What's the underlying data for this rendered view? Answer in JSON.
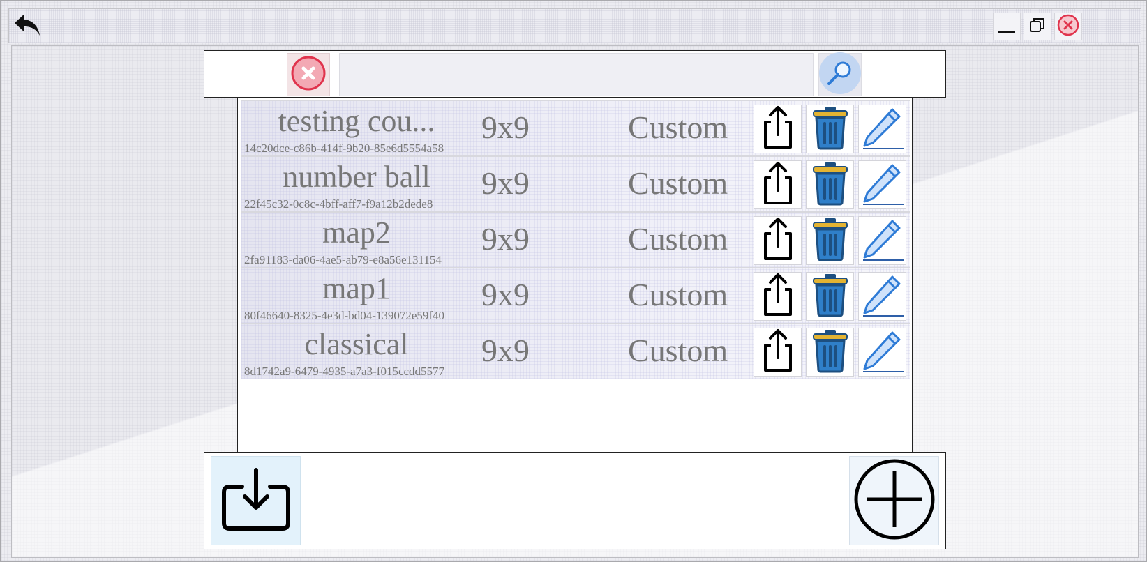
{
  "titlebar": {
    "icons": [
      "back-arrow-icon",
      "minimize-icon",
      "restore-icon",
      "close-icon"
    ]
  },
  "search": {
    "value": "",
    "placeholder": "",
    "icons": [
      "clear-icon",
      "search-magnifier-icon"
    ]
  },
  "maps": [
    {
      "name": "testing cou...",
      "id": "14c20dce-c86b-414f-9b20-85e6d5554a58",
      "size": "9x9",
      "type": "Custom"
    },
    {
      "name": "number ball",
      "id": "22f45c32-0c8c-4bff-aff7-f9a12b2dede8",
      "size": "9x9",
      "type": "Custom"
    },
    {
      "name": "map2",
      "id": "2fa91183-da06-4ae5-ab79-e8a56e131154",
      "size": "9x9",
      "type": "Custom"
    },
    {
      "name": "map1",
      "id": "80f46640-8325-4e3d-bd04-139072e59f40",
      "size": "9x9",
      "type": "Custom"
    },
    {
      "name": "classical",
      "id": "8d1742a9-6479-4935-a7a3-f015ccdd5577",
      "size": "9x9",
      "type": "Custom"
    }
  ],
  "row_icons": [
    "share-icon",
    "trash-icon",
    "pencil-icon"
  ],
  "bottombar": {
    "icons": [
      "import-icon",
      "add-circle-icon"
    ]
  },
  "colors": {
    "close_red": "#e0344d",
    "trash_blue": "#2f7fc9",
    "trash_lid": "#e3b332",
    "pencil_blue": "#2e7bd6",
    "text_gray": "#777777"
  }
}
